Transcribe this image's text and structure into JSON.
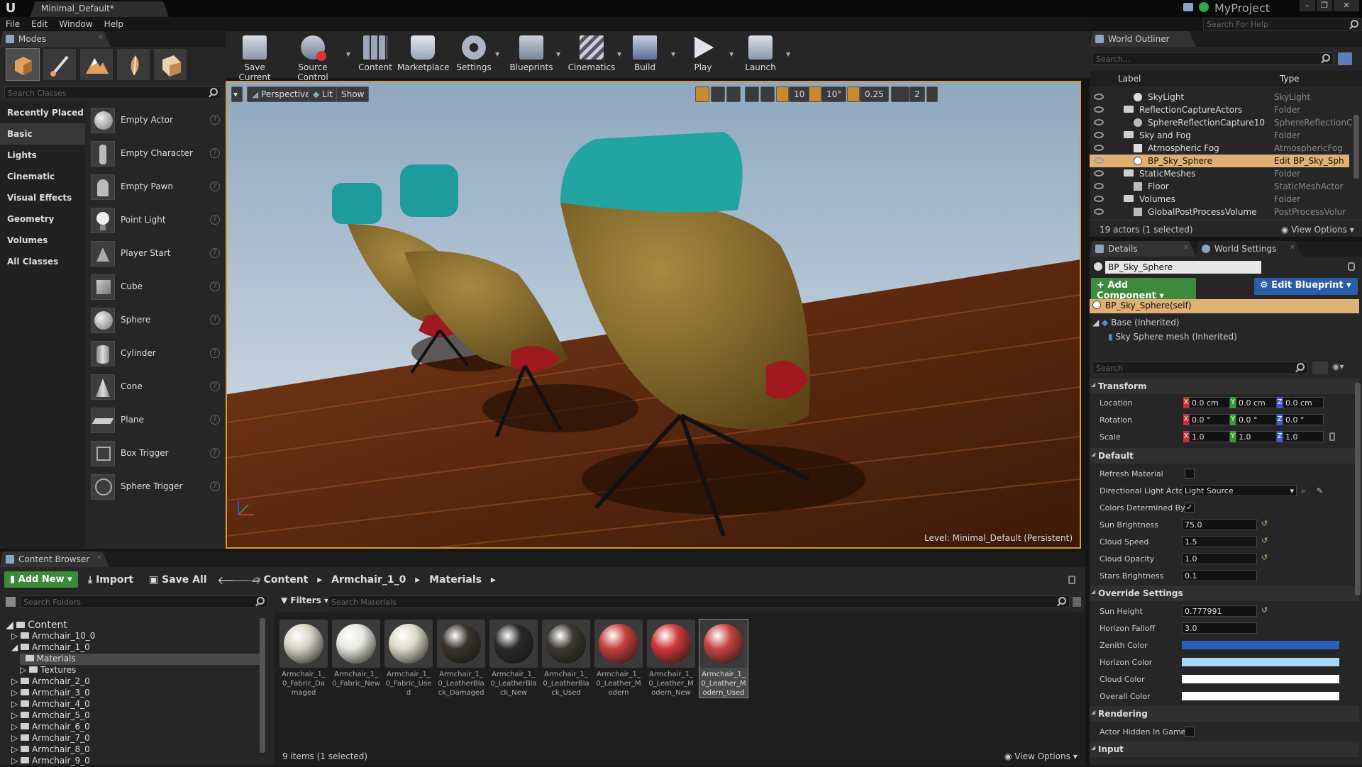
{
  "window": {
    "doc_tab": "Minimal_Default*",
    "project": "MyProject",
    "help_search_placeholder": "Search For Help",
    "controls": [
      "–",
      "❐",
      "✕"
    ]
  },
  "menu": [
    "File",
    "Edit",
    "Window",
    "Help"
  ],
  "modes": {
    "tab": "Modes",
    "search_placeholder": "Search Classes",
    "categories": [
      "Recently Placed",
      "Basic",
      "Lights",
      "Cinematic",
      "Visual Effects",
      "Geometry",
      "Volumes",
      "All Classes"
    ],
    "selected_category": "Basic",
    "actors": [
      "Empty Actor",
      "Empty Character",
      "Empty Pawn",
      "Point Light",
      "Player Start",
      "Cube",
      "Sphere",
      "Cylinder",
      "Cone",
      "Plane",
      "Box Trigger",
      "Sphere Trigger"
    ]
  },
  "toolbar": [
    {
      "label": "Save Current",
      "icon": "save-icon"
    },
    {
      "label": "Source Control",
      "icon": "source-control-icon"
    },
    {
      "label": "Content",
      "icon": "content-icon"
    },
    {
      "label": "Marketplace",
      "icon": "marketplace-icon"
    },
    {
      "label": "Settings",
      "icon": "settings-icon"
    },
    {
      "label": "Blueprints",
      "icon": "blueprints-icon"
    },
    {
      "label": "Cinematics",
      "icon": "cinematics-icon"
    },
    {
      "label": "Build",
      "icon": "build-icon"
    },
    {
      "label": "Play",
      "icon": "play-icon"
    },
    {
      "label": "Launch",
      "icon": "launch-icon"
    }
  ],
  "viewport": {
    "view_mode": "Perspective",
    "lighting": "Lit",
    "show": "Show",
    "grid_snap": "10",
    "rot_snap": "10°",
    "scale_snap": "0.25",
    "cam_speed": "2",
    "level_label": "Level:",
    "level_name": "Minimal_Default (Persistent)"
  },
  "outliner": {
    "tab": "World Outliner",
    "search_placeholder": "Search...",
    "col_label": "Label",
    "col_type": "Type",
    "rows": [
      {
        "name": "SkyLight",
        "type": "SkyLight",
        "indent": 2,
        "folder": false
      },
      {
        "name": "ReflectionCaptureActors",
        "type": "Folder",
        "indent": 1,
        "folder": true
      },
      {
        "name": "SphereReflectionCapture10",
        "type": "SphereReflectionC",
        "indent": 2,
        "folder": false
      },
      {
        "name": "Sky and Fog",
        "type": "Folder",
        "indent": 1,
        "folder": true
      },
      {
        "name": "Atmospheric Fog",
        "type": "AtmosphericFog",
        "indent": 2,
        "folder": false
      },
      {
        "name": "BP_Sky_Sphere",
        "type": "Edit BP_Sky_Sph",
        "indent": 2,
        "folder": false,
        "selected": true
      },
      {
        "name": "StaticMeshes",
        "type": "Folder",
        "indent": 1,
        "folder": true
      },
      {
        "name": "Floor",
        "type": "StaticMeshActor",
        "indent": 2,
        "folder": false
      },
      {
        "name": "Volumes",
        "type": "Folder",
        "indent": 1,
        "folder": true
      },
      {
        "name": "GlobalPostProcessVolume",
        "type": "PostProcessVolur",
        "indent": 2,
        "folder": false
      }
    ],
    "footer": "19 actors (1 selected)",
    "view_options": "View Options"
  },
  "details": {
    "tab": "Details",
    "tab2": "World Settings",
    "name_value": "BP_Sky_Sphere",
    "add_component": "+ Add Component",
    "edit_blueprint": "Edit Blueprint",
    "self_row": "BP_Sky_Sphere(self)",
    "base": "Base (Inherited)",
    "mesh": "Sky Sphere mesh (Inherited)",
    "search_placeholder": "Search",
    "transform": {
      "title": "Transform",
      "location": {
        "label": "Location",
        "x": "0.0 cm",
        "y": "0.0 cm",
        "z": "0.0 cm"
      },
      "rotation": {
        "label": "Rotation",
        "x": "0.0 °",
        "y": "0.0 °",
        "z": "0.0 °"
      },
      "scale": {
        "label": "Scale",
        "x": "1.0",
        "y": "1.0",
        "z": "1.0"
      }
    },
    "default": {
      "title": "Default",
      "refresh_material": "Refresh Material",
      "dir_light": "Directional Light Actor",
      "dir_light_value": "Light Source",
      "colors_det": "Colors Determined By",
      "sun_brightness": "Sun Brightness",
      "sun_brightness_v": "75.0",
      "cloud_speed": "Cloud Speed",
      "cloud_speed_v": "1.5",
      "cloud_opacity": "Cloud Opacity",
      "cloud_opacity_v": "1.0",
      "stars": "Stars Brightness",
      "stars_v": "0.1"
    },
    "override": {
      "title": "Override Settings",
      "sun_height": "Sun Height",
      "sun_height_v": "0.777991",
      "horizon_falloff": "Horizon Falloff",
      "horizon_falloff_v": "3.0",
      "zenith": "Zenith Color",
      "horizon": "Horizon Color",
      "cloud": "Cloud Color",
      "overall": "Overall Color"
    },
    "rendering": {
      "title": "Rendering",
      "hidden": "Actor Hidden In Game"
    },
    "input": {
      "title": "Input"
    },
    "colors": {
      "zenith": "#2b5fb8",
      "horizon": "#a8d8f4",
      "cloud": "#ffffff",
      "overall": "#ffffff"
    }
  },
  "content_browser": {
    "tab": "Content Browser",
    "add_new": "Add New",
    "import": "Import",
    "save_all": "Save All",
    "path": [
      "Content",
      "Armchair_1_0",
      "Materials"
    ],
    "folder_search": "Search Folders",
    "filters": "Filters",
    "asset_search": "Search Materials",
    "tree": [
      {
        "name": "Content",
        "indent": 0
      },
      {
        "name": "Armchair_10_0",
        "indent": 1
      },
      {
        "name": "Armchair_1_0",
        "indent": 1
      },
      {
        "name": "Materials",
        "indent": 2,
        "selected": true
      },
      {
        "name": "Textures",
        "indent": 2
      },
      {
        "name": "Armchair_2_0",
        "indent": 1
      },
      {
        "name": "Armchair_3_0",
        "indent": 1
      },
      {
        "name": "Armchair_4_0",
        "indent": 1
      },
      {
        "name": "Armchair_5_0",
        "indent": 1
      },
      {
        "name": "Armchair_6_0",
        "indent": 1
      },
      {
        "name": "Armchair_7_0",
        "indent": 1
      },
      {
        "name": "Armchair_8_0",
        "indent": 1
      },
      {
        "name": "Armchair_9_0",
        "indent": 1
      }
    ],
    "assets": [
      {
        "name": "Armchair_1_0_Fabric_Damaged",
        "color": "#d8d4c4"
      },
      {
        "name": "Armchair_1_0_Fabric_New",
        "color": "#e6e8dc"
      },
      {
        "name": "Armchair_1_0_Fabric_Used",
        "color": "#dedcc8"
      },
      {
        "name": "Armchair_1_0_LeatherBlack_Damaged",
        "color": "#3a342c"
      },
      {
        "name": "Armchair_1_0_LeatherBlack_New",
        "color": "#2a2a2a"
      },
      {
        "name": "Armchair_1_0_LeatherBlack_Used",
        "color": "#3c3830"
      },
      {
        "name": "Armchair_1_0_Leather_Modern",
        "color": "#c8403c"
      },
      {
        "name": "Armchair_1_0_Leather_Modern_New",
        "color": "#d0383a"
      },
      {
        "name": "Armchair_1_0_Leather_Modern_Used",
        "color": "#c84444"
      }
    ],
    "status": "9 items (1 selected)",
    "view_options": "View Options"
  }
}
